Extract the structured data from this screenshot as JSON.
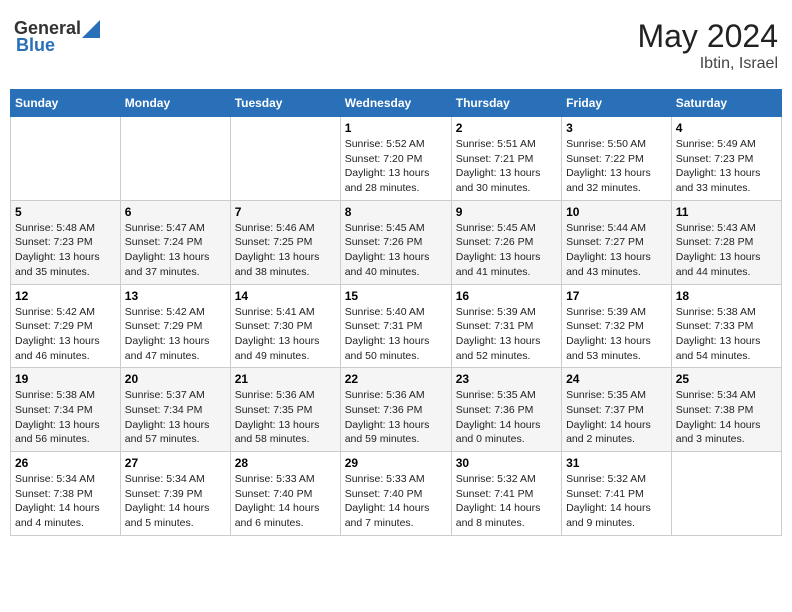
{
  "header": {
    "logo_general": "General",
    "logo_blue": "Blue",
    "month_year": "May 2024",
    "location": "Ibtin, Israel"
  },
  "days_of_week": [
    "Sunday",
    "Monday",
    "Tuesday",
    "Wednesday",
    "Thursday",
    "Friday",
    "Saturday"
  ],
  "weeks": [
    [
      {
        "day": "",
        "info": ""
      },
      {
        "day": "",
        "info": ""
      },
      {
        "day": "",
        "info": ""
      },
      {
        "day": "1",
        "info": "Sunrise: 5:52 AM\nSunset: 7:20 PM\nDaylight: 13 hours\nand 28 minutes."
      },
      {
        "day": "2",
        "info": "Sunrise: 5:51 AM\nSunset: 7:21 PM\nDaylight: 13 hours\nand 30 minutes."
      },
      {
        "day": "3",
        "info": "Sunrise: 5:50 AM\nSunset: 7:22 PM\nDaylight: 13 hours\nand 32 minutes."
      },
      {
        "day": "4",
        "info": "Sunrise: 5:49 AM\nSunset: 7:23 PM\nDaylight: 13 hours\nand 33 minutes."
      }
    ],
    [
      {
        "day": "5",
        "info": "Sunrise: 5:48 AM\nSunset: 7:23 PM\nDaylight: 13 hours\nand 35 minutes."
      },
      {
        "day": "6",
        "info": "Sunrise: 5:47 AM\nSunset: 7:24 PM\nDaylight: 13 hours\nand 37 minutes."
      },
      {
        "day": "7",
        "info": "Sunrise: 5:46 AM\nSunset: 7:25 PM\nDaylight: 13 hours\nand 38 minutes."
      },
      {
        "day": "8",
        "info": "Sunrise: 5:45 AM\nSunset: 7:26 PM\nDaylight: 13 hours\nand 40 minutes."
      },
      {
        "day": "9",
        "info": "Sunrise: 5:45 AM\nSunset: 7:26 PM\nDaylight: 13 hours\nand 41 minutes."
      },
      {
        "day": "10",
        "info": "Sunrise: 5:44 AM\nSunset: 7:27 PM\nDaylight: 13 hours\nand 43 minutes."
      },
      {
        "day": "11",
        "info": "Sunrise: 5:43 AM\nSunset: 7:28 PM\nDaylight: 13 hours\nand 44 minutes."
      }
    ],
    [
      {
        "day": "12",
        "info": "Sunrise: 5:42 AM\nSunset: 7:29 PM\nDaylight: 13 hours\nand 46 minutes."
      },
      {
        "day": "13",
        "info": "Sunrise: 5:42 AM\nSunset: 7:29 PM\nDaylight: 13 hours\nand 47 minutes."
      },
      {
        "day": "14",
        "info": "Sunrise: 5:41 AM\nSunset: 7:30 PM\nDaylight: 13 hours\nand 49 minutes."
      },
      {
        "day": "15",
        "info": "Sunrise: 5:40 AM\nSunset: 7:31 PM\nDaylight: 13 hours\nand 50 minutes."
      },
      {
        "day": "16",
        "info": "Sunrise: 5:39 AM\nSunset: 7:31 PM\nDaylight: 13 hours\nand 52 minutes."
      },
      {
        "day": "17",
        "info": "Sunrise: 5:39 AM\nSunset: 7:32 PM\nDaylight: 13 hours\nand 53 minutes."
      },
      {
        "day": "18",
        "info": "Sunrise: 5:38 AM\nSunset: 7:33 PM\nDaylight: 13 hours\nand 54 minutes."
      }
    ],
    [
      {
        "day": "19",
        "info": "Sunrise: 5:38 AM\nSunset: 7:34 PM\nDaylight: 13 hours\nand 56 minutes."
      },
      {
        "day": "20",
        "info": "Sunrise: 5:37 AM\nSunset: 7:34 PM\nDaylight: 13 hours\nand 57 minutes."
      },
      {
        "day": "21",
        "info": "Sunrise: 5:36 AM\nSunset: 7:35 PM\nDaylight: 13 hours\nand 58 minutes."
      },
      {
        "day": "22",
        "info": "Sunrise: 5:36 AM\nSunset: 7:36 PM\nDaylight: 13 hours\nand 59 minutes."
      },
      {
        "day": "23",
        "info": "Sunrise: 5:35 AM\nSunset: 7:36 PM\nDaylight: 14 hours\nand 0 minutes."
      },
      {
        "day": "24",
        "info": "Sunrise: 5:35 AM\nSunset: 7:37 PM\nDaylight: 14 hours\nand 2 minutes."
      },
      {
        "day": "25",
        "info": "Sunrise: 5:34 AM\nSunset: 7:38 PM\nDaylight: 14 hours\nand 3 minutes."
      }
    ],
    [
      {
        "day": "26",
        "info": "Sunrise: 5:34 AM\nSunset: 7:38 PM\nDaylight: 14 hours\nand 4 minutes."
      },
      {
        "day": "27",
        "info": "Sunrise: 5:34 AM\nSunset: 7:39 PM\nDaylight: 14 hours\nand 5 minutes."
      },
      {
        "day": "28",
        "info": "Sunrise: 5:33 AM\nSunset: 7:40 PM\nDaylight: 14 hours\nand 6 minutes."
      },
      {
        "day": "29",
        "info": "Sunrise: 5:33 AM\nSunset: 7:40 PM\nDaylight: 14 hours\nand 7 minutes."
      },
      {
        "day": "30",
        "info": "Sunrise: 5:32 AM\nSunset: 7:41 PM\nDaylight: 14 hours\nand 8 minutes."
      },
      {
        "day": "31",
        "info": "Sunrise: 5:32 AM\nSunset: 7:41 PM\nDaylight: 14 hours\nand 9 minutes."
      },
      {
        "day": "",
        "info": ""
      }
    ]
  ]
}
